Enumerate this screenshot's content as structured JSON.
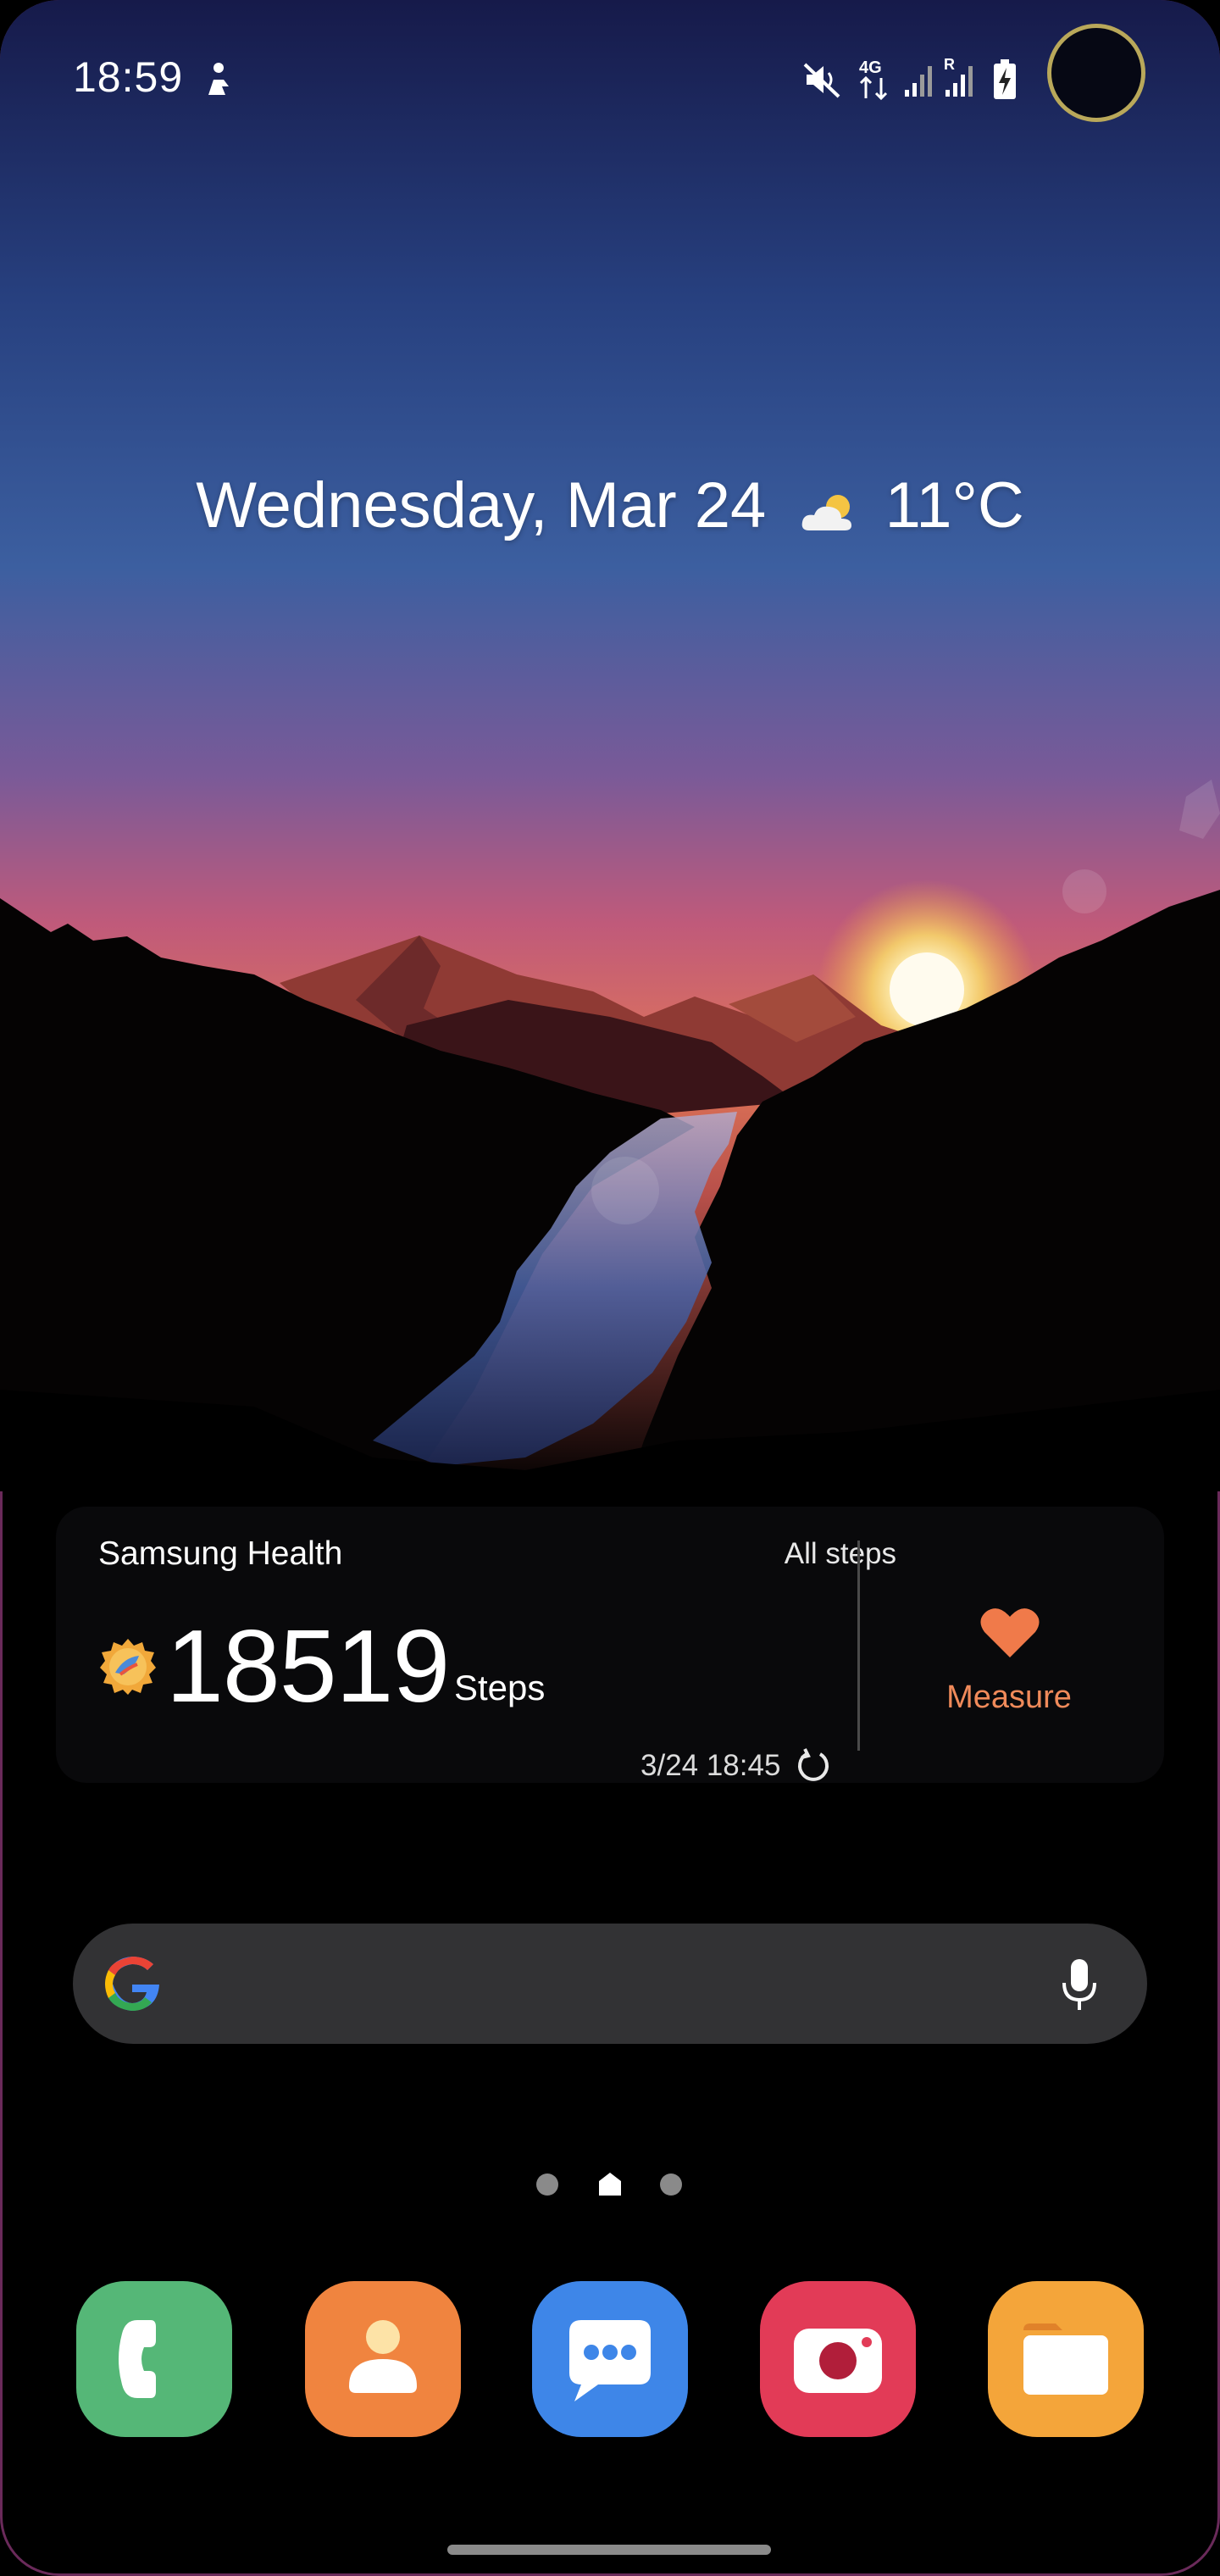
{
  "status_bar": {
    "time": "18:59",
    "icons": [
      "person-notification-icon",
      "mute-icon",
      "4g-data-icon",
      "signal-icon",
      "roaming-signal-icon",
      "battery-charging-icon"
    ],
    "network_label": "4G",
    "roaming_label": "R"
  },
  "lock_info": {
    "date": "Wednesday, Mar 24",
    "weather_icon": "partly-cloudy-icon",
    "temperature": "11°C"
  },
  "health_widget": {
    "title": "Samsung Health",
    "filter": "All steps",
    "steps": "18519",
    "steps_label": "Steps",
    "updated": "3/24 18:45",
    "measure_label": "Measure",
    "accent_color": "#f08a5a"
  },
  "search_bar": {
    "left_icon": "google-g-icon",
    "right_icon": "microphone-icon"
  },
  "page_indicator": {
    "pages": 3,
    "current": 2
  },
  "dock": [
    {
      "name": "Phone",
      "icon": "phone-icon",
      "color": "#55b777"
    },
    {
      "name": "Contacts",
      "icon": "contacts-icon",
      "color": "#f0843f"
    },
    {
      "name": "Messages",
      "icon": "messages-icon",
      "color": "#3e86e8"
    },
    {
      "name": "Camera",
      "icon": "camera-icon",
      "color": "#e23b57"
    },
    {
      "name": "My Files",
      "icon": "folder-icon",
      "color": "#f4a53a"
    }
  ]
}
